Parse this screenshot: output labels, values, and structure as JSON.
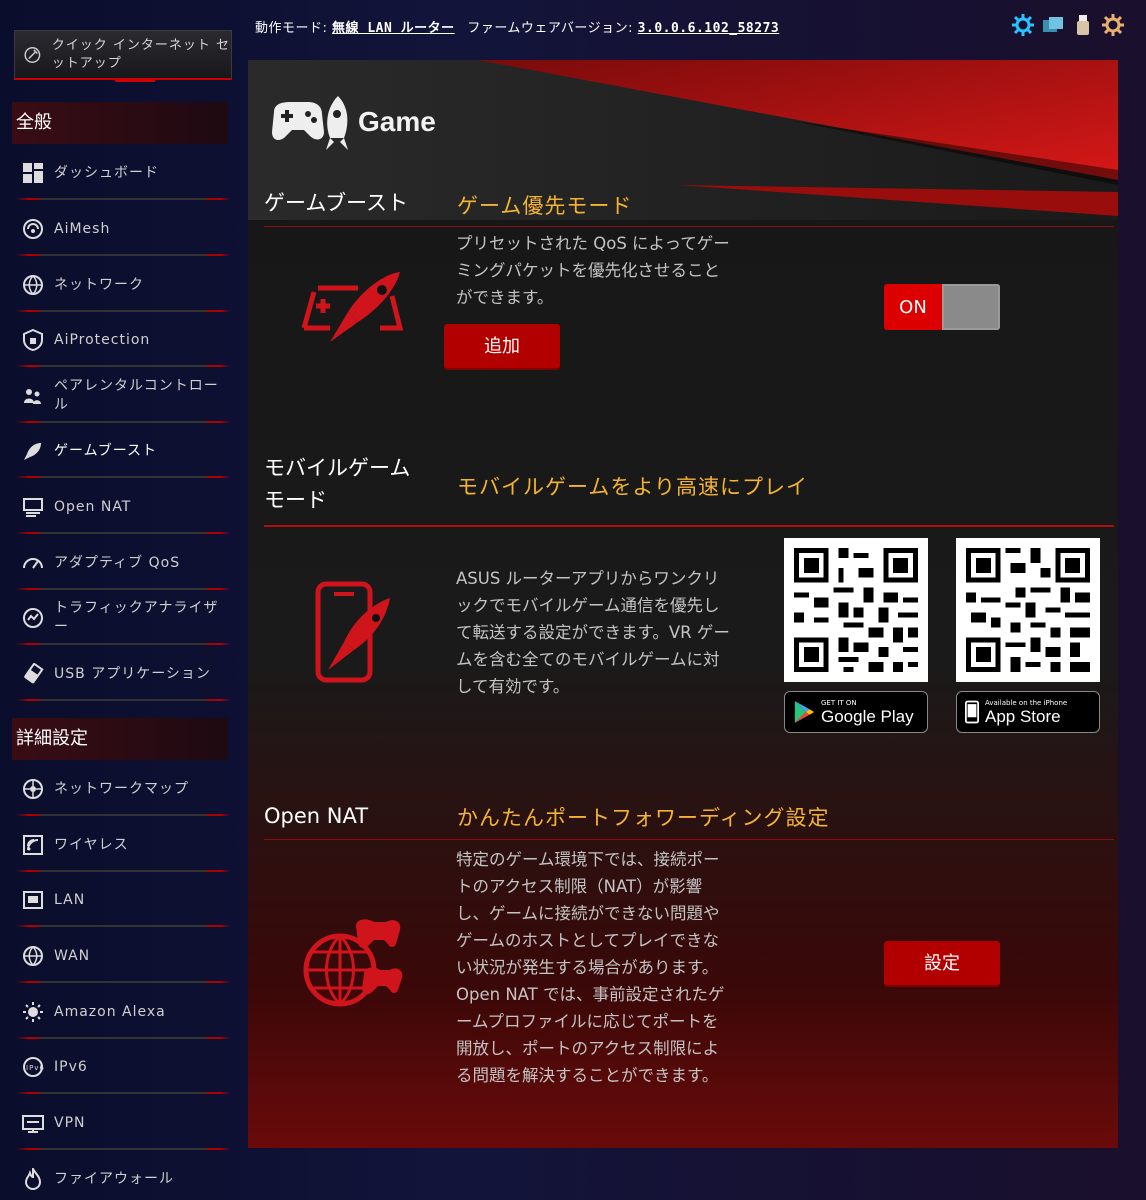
{
  "sidebar": {
    "quick_setup": "クイック インターネット セットアップ",
    "general_header": "全般",
    "general_items": [
      {
        "label": "ダッシュボード"
      },
      {
        "label": "AiMesh"
      },
      {
        "label": "ネットワーク"
      },
      {
        "label": "AiProtection"
      },
      {
        "label": "ペアレンタルコントロール"
      },
      {
        "label": "ゲームブースト"
      },
      {
        "label": "Open NAT"
      },
      {
        "label": "アダプティブ QoS"
      },
      {
        "label": "トラフィックアナライザー"
      },
      {
        "label": "USB アプリケーション"
      }
    ],
    "advanced_header": "詳細設定",
    "advanced_items": [
      {
        "label": "ネットワークマップ"
      },
      {
        "label": "ワイヤレス"
      },
      {
        "label": "LAN"
      },
      {
        "label": "WAN"
      },
      {
        "label": "Amazon Alexa"
      },
      {
        "label": "IPv6"
      },
      {
        "label": "VPN"
      },
      {
        "label": "ファイアウォール"
      }
    ]
  },
  "topbar": {
    "mode_label": "動作モード:",
    "mode_value": "無線 LAN ルーター",
    "fw_label": "ファームウェアバージョン:",
    "fw_value": "3.0.0.6.102_58273",
    "icons": [
      "gear-icon",
      "network-icon",
      "usb-icon",
      "settings-icon"
    ]
  },
  "main": {
    "title": "Game",
    "game_boost": {
      "label": "ゲームブースト",
      "title": "ゲーム優先モード",
      "desc_lines": [
        "プリセットされた QoS によってゲー",
        "ミングパケットを優先化させること",
        "ができます。"
      ],
      "add_button": "追加",
      "toggle_on": "ON"
    },
    "mobile": {
      "label_line1": "モバイルゲーム",
      "label_line2": "モード",
      "title": "モバイルゲームをより高速にプレイ",
      "desc_lines": [
        "ASUS ルーターアプリからワンクリ",
        "ックでモバイルゲーム通信を優先し",
        "て転送する設定ができます。VR ゲー",
        "ムを含む全てのモバイルゲームに対",
        "して有効です。"
      ],
      "google_small": "GET IT ON",
      "google_big": "Google Play",
      "apple_small": "Available on the iPhone",
      "apple_big": "App Store"
    },
    "open_nat": {
      "label": "Open NAT",
      "title": "かんたんポートフォワーディング設定",
      "desc_lines": [
        "特定のゲーム環境下では、接続ポー",
        "トのアクセス制限（NAT）が影響",
        "し、ゲームに接続ができない問題や",
        "ゲームのホストとしてプレイできな",
        "い状況が発生する場合があります。",
        "Open NAT では、事前設定されたゲ",
        "ームプロファイルに応じてポートを",
        "開放し、ポートのアクセス制限によ",
        "る問題を解決することができます。"
      ],
      "setup_button": "設定"
    }
  },
  "colors": {
    "accent": "#b20000",
    "title_gold": "#f5b430"
  }
}
